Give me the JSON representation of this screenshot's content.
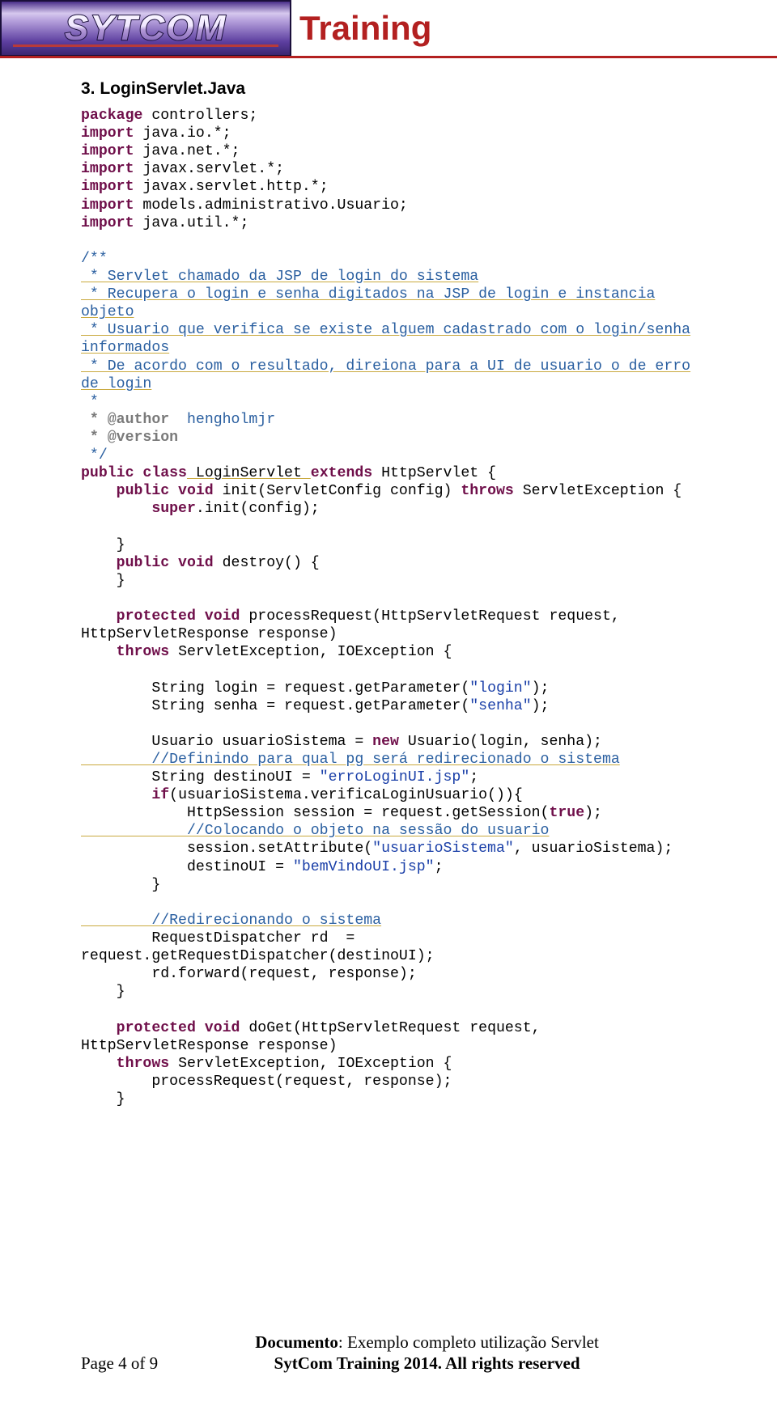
{
  "banner": {
    "logo_text": "SYTCOM",
    "title": "Training"
  },
  "section_heading": "3. LoginServlet.Java",
  "code": {
    "l01_kw": "package",
    "l01_rest": " controllers;",
    "l02_kw": "import",
    "l02_rest": " java.io.*;",
    "l03_kw": "import",
    "l03_rest": " java.net.*;",
    "l04_kw": "import",
    "l04_rest": " javax.servlet.*;",
    "l05_kw": "import",
    "l05_rest": " javax.servlet.http.*;",
    "l06_kw": "import",
    "l06_rest": " models.administrativo.Usuario;",
    "l07_kw": "import",
    "l07_rest": " java.util.*;",
    "c01": "/**",
    "c02": " * Servlet chamado da JSP de login do sistema",
    "c03a": " * Recupera o login e senha digitados na JSP de login e instancia",
    "c03b": "objeto",
    "c04a": " * Usuario que verifica se existe alguem cadastrado com o login/senha",
    "c04b": "informados",
    "c05a": " * De acordo com o resultado, direiona para a UI de usuario o de erro",
    "c05b": "de login",
    "c06": " *",
    "c07_tag": " * @author",
    "c07_val": "  hengholmjr",
    "c08_tag": " * @version",
    "c09": " */",
    "d01_a": "public class",
    "d01_b": " LoginServlet ",
    "d01_c": "extends",
    "d01_d": " HttpServlet {",
    "d02_a": "    public void",
    "d02_b": " init(ServletConfig config) ",
    "d02_c": "throws",
    "d02_d": " ServletException {",
    "d03_a": "        super",
    "d03_b": ".init(config);",
    "d05": "    }",
    "d06_a": "    public void",
    "d06_b": " destroy() {",
    "d07": "    }",
    "p01_a": "    protected void",
    "p01_b": " processRequest(HttpServletRequest request,",
    "p01c": "HttpServletResponse response)",
    "p02_a": "    throws",
    "p02_b": " ServletException, IOException {",
    "p04_a": "        String login = request.getParameter(",
    "p04_s": "\"login\"",
    "p04_b": ");",
    "p05_a": "        String senha = request.getParameter(",
    "p05_s": "\"senha\"",
    "p05_b": ");",
    "p07_a": "        Usuario usuarioSistema = ",
    "p07_kw": "new",
    "p07_b": " Usuario(login, senha);",
    "p08": "        //Definindo para qual pg será redirecionado o sistema",
    "p09_a": "        String destinoUI = ",
    "p09_s": "\"erroLoginUI.jsp\"",
    "p09_b": ";",
    "p10_a": "        if",
    "p10_b": "(usuarioSistema.verificaLoginUsuario()){",
    "p11_a": "            HttpSession session = request.getSession(",
    "p11_kw": "true",
    "p11_b": ");",
    "p12": "            //Colocando o objeto na sessão do usuario",
    "p13_a": "            session.setAttribute(",
    "p13_s": "\"usuarioSistema\"",
    "p13_b": ", usuarioSistema);",
    "p14_a": "            destinoUI = ",
    "p14_s": "\"bemVindoUI.jsp\"",
    "p14_b": ";",
    "p15": "        }",
    "p17": "        //Redirecionando o sistema",
    "p18": "        RequestDispatcher rd  =",
    "p18b": "request.getRequestDispatcher(destinoUI);",
    "p19": "        rd.forward(request, response);",
    "p20": "    }",
    "g01_a": "    protected void",
    "g01_b": " doGet(HttpServletRequest request,",
    "g01c": "HttpServletResponse response)",
    "g02_a": "    throws",
    "g02_b": " ServletException, IOException {",
    "g03": "        processRequest(request, response);",
    "g04": "    }"
  },
  "footer": {
    "page": "Page 4 of 9",
    "doc_label": "Documento",
    "doc_value": ": Exemplo completo utilização Servlet",
    "copyright": "SytCom Training 2014. All rights reserved"
  }
}
